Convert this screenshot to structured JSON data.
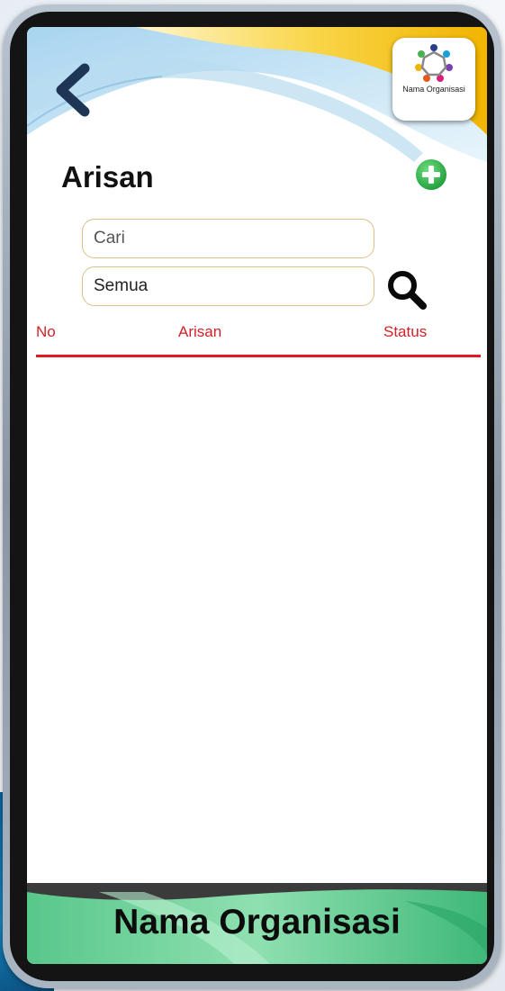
{
  "header": {
    "back_icon": "chevron-left-icon",
    "org_logo_icon": "people-circle-icon",
    "org_logo_label": "Nama Organisasi"
  },
  "page": {
    "title": "Arisan",
    "add_icon": "plus-circle-icon"
  },
  "search": {
    "query_value": "Cari",
    "filter_value": "Semua",
    "search_icon": "magnifier-icon"
  },
  "table": {
    "columns": [
      "No",
      "Arisan",
      "Status"
    ],
    "rows": []
  },
  "footer": {
    "title": "Nama Organisasi"
  },
  "colors": {
    "accent_red": "#e01a23",
    "add_green": "#2db34a",
    "field_border": "#dcc08a",
    "back_navy": "#1f3556",
    "footer_green": "#6fd39a",
    "header_gold": "#f6c21a"
  }
}
